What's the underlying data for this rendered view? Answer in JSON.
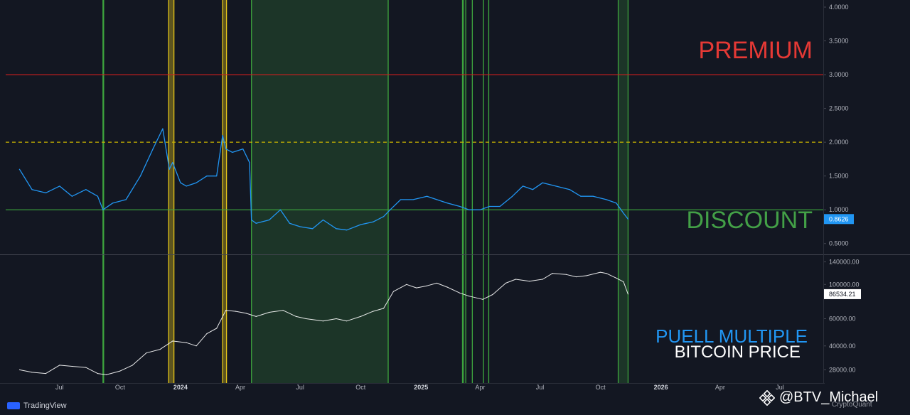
{
  "chart_data": [
    {
      "type": "line",
      "name": "puell-multiple-panel",
      "y_axis": {
        "ticks": [
          "4.0000",
          "3.5000",
          "3.0000",
          "2.5000",
          "2.0000",
          "1.5000",
          "1.0000",
          "0.5000"
        ],
        "ylim": [
          0.35,
          4.0
        ]
      },
      "last_value_label": "0.8626",
      "reference_lines": [
        {
          "value": 3.0,
          "color": "#cc1f1f",
          "style": "solid"
        },
        {
          "value": 2.0,
          "color": "#c8b400",
          "style": "dashed"
        },
        {
          "value": 1.0,
          "color": "#3ea63e",
          "style": "solid"
        }
      ],
      "series": [
        {
          "color": "#2196f3",
          "x": [
            "2023-05-01",
            "2023-05-20",
            "2023-06-10",
            "2023-07-01",
            "2023-07-20",
            "2023-08-10",
            "2023-08-28",
            "2023-09-05",
            "2023-09-20",
            "2023-10-10",
            "2023-11-01",
            "2023-11-20",
            "2023-12-05",
            "2023-12-15",
            "2023-12-20",
            "2024-01-01",
            "2024-01-10",
            "2024-01-25",
            "2024-02-10",
            "2024-02-25",
            "2024-03-05",
            "2024-03-10",
            "2024-03-20",
            "2024-04-05",
            "2024-04-15",
            "2024-04-18",
            "2024-04-25",
            "2024-05-15",
            "2024-06-01",
            "2024-06-15",
            "2024-07-01",
            "2024-07-20",
            "2024-08-05",
            "2024-08-25",
            "2024-09-10",
            "2024-10-01",
            "2024-10-20",
            "2024-11-05",
            "2024-11-15",
            "2024-12-01",
            "2024-12-20",
            "2025-01-10",
            "2025-01-25",
            "2025-02-10",
            "2025-03-01",
            "2025-03-15",
            "2025-04-01",
            "2025-04-15",
            "2025-05-01",
            "2025-05-20",
            "2025-06-05",
            "2025-06-20",
            "2025-07-05",
            "2025-07-25",
            "2025-08-15",
            "2025-09-01",
            "2025-09-20",
            "2025-10-10",
            "2025-10-25",
            "2025-11-05",
            "2025-11-12"
          ],
          "y": [
            1.6,
            1.3,
            1.25,
            1.35,
            1.2,
            1.3,
            1.2,
            1.0,
            1.1,
            1.15,
            1.5,
            1.9,
            2.2,
            1.6,
            1.7,
            1.4,
            1.35,
            1.4,
            1.5,
            1.5,
            2.1,
            1.9,
            1.85,
            1.9,
            1.7,
            0.85,
            0.8,
            0.85,
            1.0,
            0.8,
            0.75,
            0.72,
            0.85,
            0.72,
            0.7,
            0.78,
            0.82,
            0.9,
            1.0,
            1.15,
            1.15,
            1.2,
            1.15,
            1.1,
            1.05,
            1.0,
            1.0,
            1.05,
            1.05,
            1.2,
            1.35,
            1.3,
            1.4,
            1.35,
            1.3,
            1.2,
            1.2,
            1.15,
            1.1,
            0.95,
            0.8626
          ]
        }
      ],
      "annotations": [
        "PREMIUM",
        "DISCOUNT",
        "PUELL MULTIPLE"
      ]
    },
    {
      "type": "line",
      "name": "bitcoin-price-panel",
      "y_axis": {
        "ticks": [
          "140000.00",
          "100000.00",
          "86534.21",
          "60000.00",
          "40000.00",
          "28000.00"
        ],
        "scale": "log",
        "ylim": [
          24000,
          150000
        ]
      },
      "last_value_label": "86534.21",
      "series": [
        {
          "color": "#ffffff",
          "x": [
            "2023-05-01",
            "2023-05-20",
            "2023-06-10",
            "2023-07-01",
            "2023-07-20",
            "2023-08-10",
            "2023-08-28",
            "2023-09-10",
            "2023-10-01",
            "2023-10-20",
            "2023-11-10",
            "2023-12-01",
            "2023-12-20",
            "2024-01-10",
            "2024-01-25",
            "2024-02-10",
            "2024-02-25",
            "2024-03-10",
            "2024-03-25",
            "2024-04-10",
            "2024-04-25",
            "2024-05-15",
            "2024-06-05",
            "2024-06-25",
            "2024-07-10",
            "2024-08-05",
            "2024-08-25",
            "2024-09-10",
            "2024-10-01",
            "2024-10-20",
            "2024-11-05",
            "2024-11-20",
            "2024-12-10",
            "2024-12-25",
            "2025-01-10",
            "2025-01-25",
            "2025-02-10",
            "2025-03-01",
            "2025-03-15",
            "2025-04-05",
            "2025-04-20",
            "2025-05-10",
            "2025-05-25",
            "2025-06-15",
            "2025-07-05",
            "2025-07-20",
            "2025-08-10",
            "2025-08-25",
            "2025-09-10",
            "2025-10-01",
            "2025-10-10",
            "2025-10-25",
            "2025-11-05",
            "2025-11-12"
          ],
          "y": [
            28000,
            27000,
            26500,
            30000,
            29500,
            29000,
            26500,
            26000,
            27500,
            30000,
            36000,
            38000,
            43000,
            42000,
            40000,
            48000,
            52000,
            68000,
            67000,
            65000,
            62000,
            66000,
            68000,
            62000,
            60000,
            58000,
            60000,
            58000,
            62000,
            67000,
            70000,
            90000,
            100000,
            95000,
            98000,
            102000,
            96000,
            88000,
            84000,
            80000,
            86000,
            102000,
            108000,
            105000,
            108000,
            118000,
            116000,
            112000,
            114000,
            120000,
            118000,
            110000,
            104000,
            86534.21
          ]
        }
      ],
      "annotations": [
        "BITCOIN PRICE"
      ]
    }
  ],
  "x_axis": {
    "range": [
      "2023-04-10",
      "2026-09-05"
    ],
    "ticks": [
      {
        "date": "2023-07-01",
        "label": "Jul",
        "bold": false
      },
      {
        "date": "2023-10-01",
        "label": "Oct",
        "bold": false
      },
      {
        "date": "2024-01-01",
        "label": "2024",
        "bold": true
      },
      {
        "date": "2024-04-01",
        "label": "Apr",
        "bold": false
      },
      {
        "date": "2024-07-01",
        "label": "Jul",
        "bold": false
      },
      {
        "date": "2024-10-01",
        "label": "Oct",
        "bold": false
      },
      {
        "date": "2025-01-01",
        "label": "2025",
        "bold": true
      },
      {
        "date": "2025-04-01",
        "label": "Apr",
        "bold": false
      },
      {
        "date": "2025-07-01",
        "label": "Jul",
        "bold": false
      },
      {
        "date": "2025-10-01",
        "label": "Oct",
        "bold": false
      },
      {
        "date": "2026-01-01",
        "label": "2026",
        "bold": true
      },
      {
        "date": "2026-04-01",
        "label": "Apr",
        "bold": false
      },
      {
        "date": "2026-07-01",
        "label": "Jul",
        "bold": false
      }
    ]
  },
  "highlight_bands": [
    {
      "start": "2023-09-05",
      "end": "2023-09-06",
      "color": "#3ea63e",
      "fill": false
    },
    {
      "start": "2023-12-14",
      "end": "2023-12-22",
      "color": "#e6c619",
      "fill": true
    },
    {
      "start": "2024-03-05",
      "end": "2024-03-11",
      "color": "#e6c619",
      "fill": true
    },
    {
      "start": "2024-04-18",
      "end": "2024-11-12",
      "color": "#3ea63e",
      "fill": true
    },
    {
      "start": "2025-03-05",
      "end": "2025-03-07",
      "color": "#3ea63e",
      "fill": false
    },
    {
      "start": "2025-03-10",
      "end": "2025-03-20",
      "color": "#3ea63e",
      "fill": false
    },
    {
      "start": "2025-04-06",
      "end": "2025-04-14",
      "color": "#3ea63e",
      "fill": false
    },
    {
      "start": "2025-10-28",
      "end": "2025-11-12",
      "color": "#3ea63e",
      "fill": true
    }
  ],
  "labels": {
    "premium": "PREMIUM",
    "discount": "DISCOUNT",
    "puell": "PUELL MULTIPLE",
    "btc": "BITCOIN PRICE"
  },
  "footer": {
    "brand": "TradingView",
    "watermark": "@BTV_Michael",
    "source": "CryptoQuant"
  },
  "colors": {
    "background": "#131722",
    "grid": "#1e222d",
    "puell_line": "#2196f3",
    "price_line": "#ffffff"
  }
}
